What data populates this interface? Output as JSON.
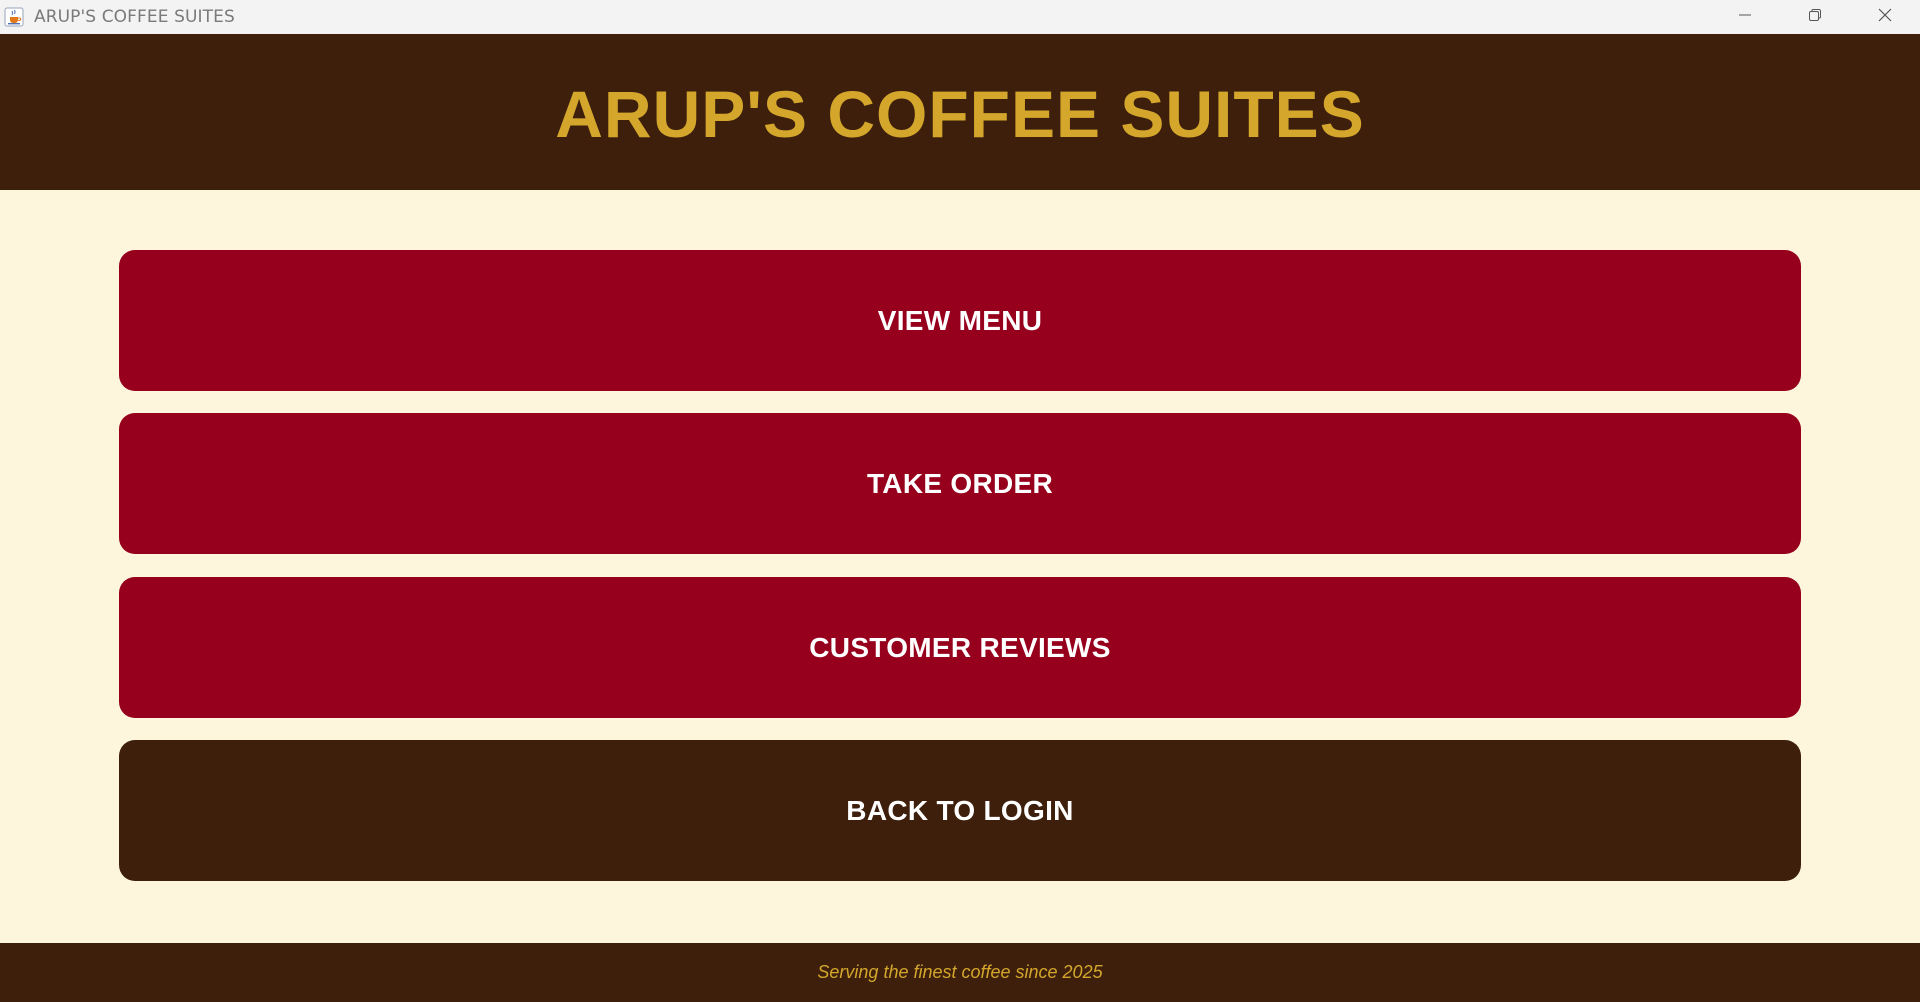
{
  "window": {
    "title": "ARUP'S COFFEE SUITES",
    "icon": "java-cup-icon",
    "controls": [
      "minimize-icon",
      "restore-icon",
      "close-icon"
    ]
  },
  "header": {
    "title": "ARUP'S COFFEE SUITES"
  },
  "menu": {
    "buttons": [
      {
        "label": "VIEW MENU",
        "color": "#96001c"
      },
      {
        "label": "TAKE ORDER",
        "color": "#96001c"
      },
      {
        "label": "CUSTOMER REVIEWS",
        "color": "#96001c"
      },
      {
        "label": "BACK TO LOGIN",
        "color": "#3d1f0c"
      }
    ]
  },
  "footer": {
    "tagline": "Serving the finest coffee since 2025"
  },
  "colors": {
    "header_bg": "#3d1f0c",
    "accent_gold": "#d4a72c",
    "primary_red": "#96001c",
    "background_cream": "#fdf6dc"
  }
}
